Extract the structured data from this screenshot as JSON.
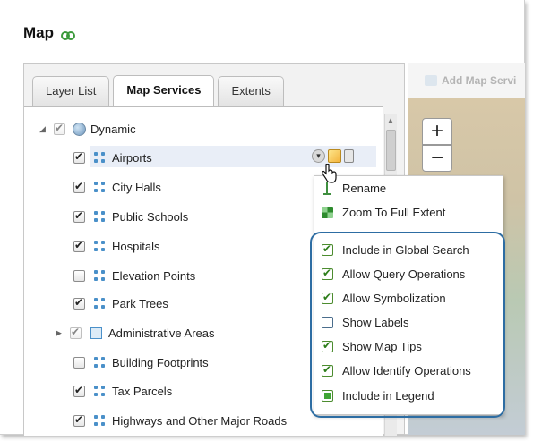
{
  "title": "Map",
  "tabs": [
    {
      "label": "Layer List",
      "active": false
    },
    {
      "label": "Map Services",
      "active": true
    },
    {
      "label": "Extents",
      "active": false
    }
  ],
  "tree": {
    "root": {
      "label": "Dynamic",
      "checked": true
    },
    "layers": [
      {
        "label": "Airports",
        "checked": true
      },
      {
        "label": "City Halls",
        "checked": true
      },
      {
        "label": "Public Schools",
        "checked": true
      },
      {
        "label": "Hospitals",
        "checked": true
      },
      {
        "label": "Elevation Points",
        "checked": false
      },
      {
        "label": "Park Trees",
        "checked": true
      },
      {
        "label": "Administrative Areas",
        "checked": true
      },
      {
        "label": "Building Footprints",
        "checked": false
      },
      {
        "label": "Tax Parcels",
        "checked": true
      },
      {
        "label": "Highways and Other Major Roads",
        "checked": true
      }
    ]
  },
  "map": {
    "add_service_label": "Add Map Servi",
    "zoom_in": "+",
    "zoom_out": "−"
  },
  "context_menu": {
    "actions": [
      {
        "label": "Rename",
        "icon": "rename-icon"
      },
      {
        "label": "Zoom To Full Extent",
        "icon": "zoom-extent-icon"
      }
    ],
    "options": [
      {
        "label": "Include in Global Search",
        "checked": true
      },
      {
        "label": "Allow Query Operations",
        "checked": true
      },
      {
        "label": "Allow Symbolization",
        "checked": true
      },
      {
        "label": "Show Labels",
        "checked": false
      },
      {
        "label": "Show Map Tips",
        "checked": true
      },
      {
        "label": "Allow Identify Operations",
        "checked": true
      },
      {
        "label": "Include in Legend",
        "checked": true
      }
    ]
  },
  "colors": {
    "highlight_border": "#2d6da3",
    "checkbox_green": "#2c7d1a"
  }
}
